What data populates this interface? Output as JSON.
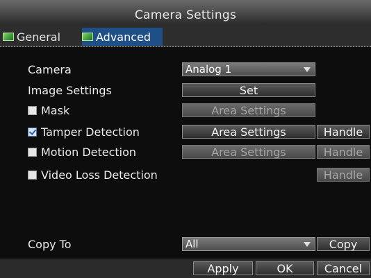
{
  "window": {
    "title": "Camera Settings"
  },
  "tabs": [
    {
      "label": "General",
      "icon": "camera-settings-icon",
      "selected": false
    },
    {
      "label": "Advanced",
      "icon": "camera-settings-icon",
      "selected": true
    }
  ],
  "form": {
    "camera": {
      "label": "Camera",
      "value": "Analog 1"
    },
    "image_settings": {
      "label": "Image Settings",
      "button": "Set"
    },
    "mask": {
      "label": "Mask",
      "checked": false,
      "button": "Area Settings"
    },
    "tamper": {
      "label": "Tamper Detection",
      "checked": true,
      "area_button": "Area Settings",
      "handle_button": "Handle"
    },
    "motion": {
      "label": "Motion Detection",
      "checked": false,
      "area_button": "Area Settings",
      "handle_button": "Handle"
    },
    "video_loss": {
      "label": "Video Loss Detection",
      "checked": false,
      "handle_button": "Handle"
    },
    "copy_to": {
      "label": "Copy To",
      "value": "All",
      "button": "Copy"
    }
  },
  "footer": {
    "apply": "Apply",
    "ok": "OK",
    "cancel": "Cancel"
  }
}
